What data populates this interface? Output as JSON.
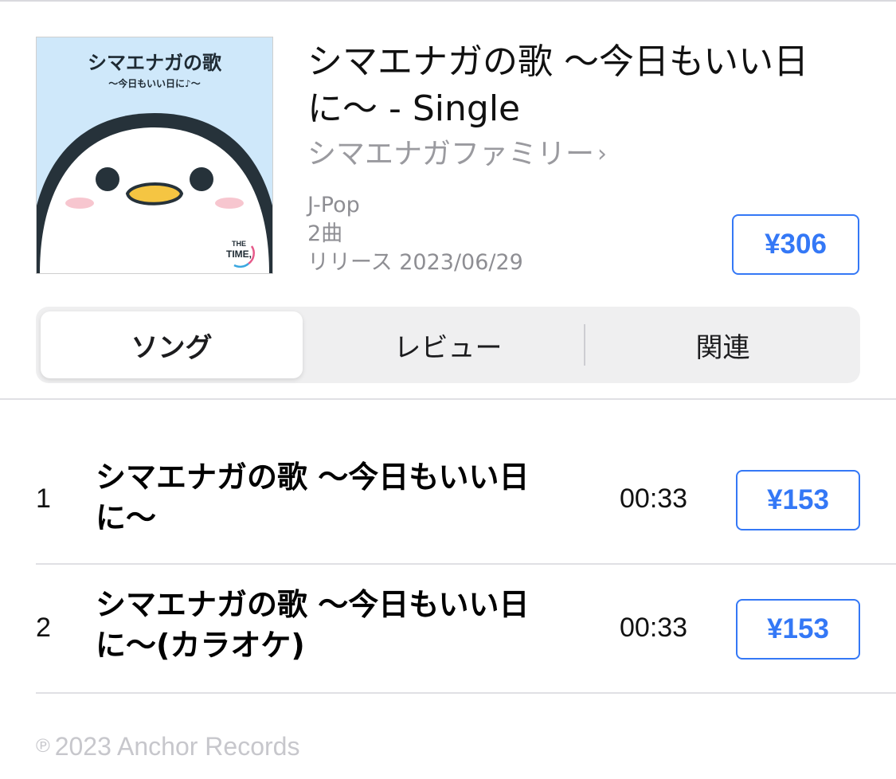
{
  "album": {
    "title": "シマエナガの歌 〜今日もいい日に〜 - Single",
    "artist": "シマエナガファミリー",
    "genre": "J-Pop",
    "track_count": "2曲",
    "release": "リリース 2023/06/29",
    "price": "¥306",
    "artwork": {
      "title": "シマエナガの歌",
      "subtitle": "〜今日もいい日に♪〜",
      "logo_line1": "THE",
      "logo_line2": "TIME,"
    }
  },
  "tabs": [
    {
      "label": "ソング",
      "active": true
    },
    {
      "label": "レビュー",
      "active": false
    },
    {
      "label": "関連",
      "active": false
    }
  ],
  "tracks": [
    {
      "number": "1",
      "title": "シマエナガの歌 〜今日もいい日に〜",
      "duration": "00:33",
      "price": "¥153"
    },
    {
      "number": "2",
      "title": "シマエナガの歌 〜今日もいい日に〜(カラオケ)",
      "duration": "00:33",
      "price": "¥153"
    }
  ],
  "footer": {
    "copyright_symbol": "℗",
    "copyright": "2023 Anchor Records"
  },
  "colors": {
    "accent": "#3478f6",
    "secondary_text": "#8e8e93",
    "artwork_bg": "#cfe8fa"
  },
  "icons": {
    "artist_chevron": "chevron-right-icon"
  }
}
